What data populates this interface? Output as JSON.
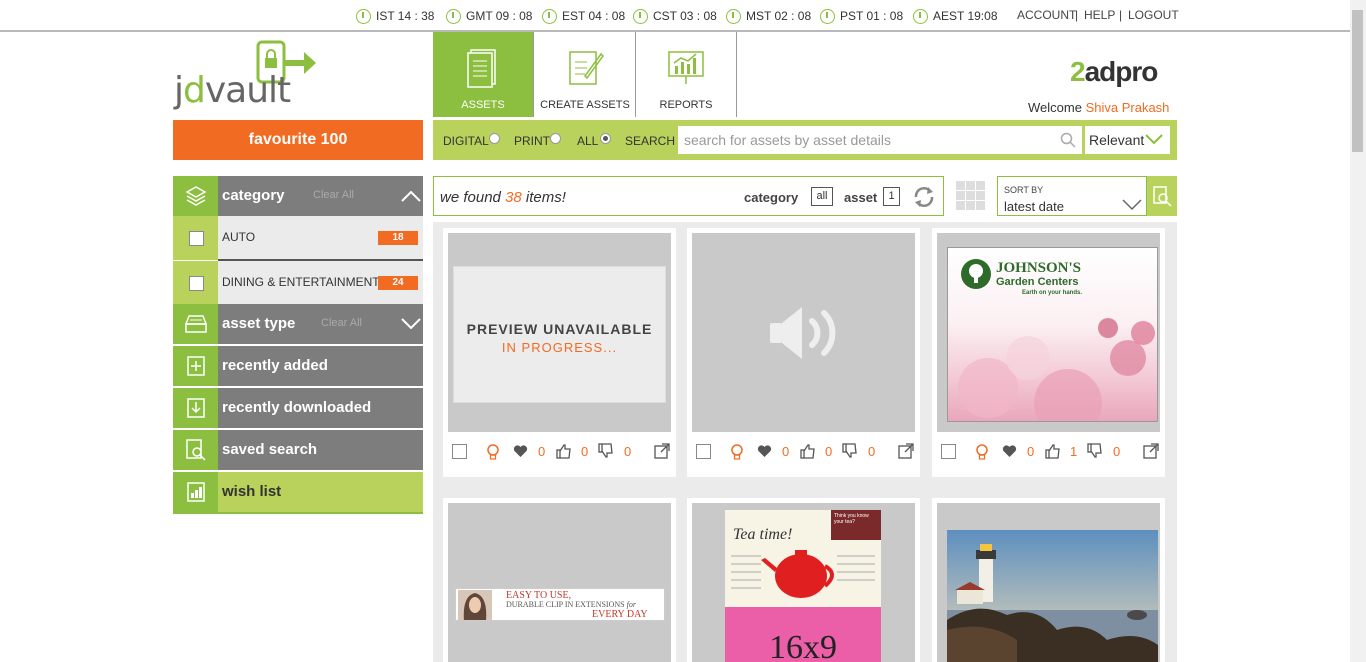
{
  "clocks": [
    {
      "label": "IST 14 : 38"
    },
    {
      "label": "GMT 09 : 08"
    },
    {
      "label": "EST 04 : 08"
    },
    {
      "label": "CST 03 : 08"
    },
    {
      "label": "MST 02 : 08"
    },
    {
      "label": "PST 01 : 08"
    },
    {
      "label": "AEST 19:08"
    }
  ],
  "toplinks": {
    "account": "ACCOUNT",
    "sep1": "|",
    "help": "HELP",
    "sep2": "|",
    "logout": "LOGOUT"
  },
  "logo": {
    "prefix": "j",
    "d": "d",
    "suffix": "vault"
  },
  "favourite": "favourite 100",
  "nav": {
    "assets": "ASSETS",
    "create": "CREATE ASSETS",
    "reports": "REPORTS"
  },
  "brand": {
    "num": "2",
    "rest": "adpro"
  },
  "welcome": {
    "label": "Welcome",
    "user": "Shiva Prakash"
  },
  "filters": {
    "digital": "DIGITAL",
    "print": "PRINT",
    "all": "ALL",
    "search": "SEARCH",
    "selected": "ALL"
  },
  "search": {
    "placeholder": "search for assets by asset details",
    "value": ""
  },
  "relevance": "Relevant",
  "sidebar": {
    "category": {
      "title": "category",
      "clear": "Clear All"
    },
    "items": [
      {
        "label": "AUTO",
        "count": "18"
      },
      {
        "label": "DINING & ENTERTAINMENT",
        "count": "24"
      }
    ],
    "asset_type": {
      "title": "asset type",
      "clear": "Clear All"
    },
    "recently_added": "recently added",
    "recently_downloaded": "recently downloaded",
    "saved_search": "saved search",
    "wish_list": "wish list"
  },
  "results": {
    "found_prefix": "we found",
    "count": "38",
    "found_suffix": "items!",
    "category_label": "category",
    "category_value": "all",
    "asset_label": "asset",
    "asset_value": "1"
  },
  "sort": {
    "label": "SORT BY",
    "value": "latest date"
  },
  "cards": [
    {
      "title": "PREVIEW UNAVAILABLE",
      "sub": "IN PROGRESS...",
      "likes": "0",
      "thumbs_up": "0",
      "thumbs_down": "0"
    },
    {
      "likes": "0",
      "thumbs_up": "0",
      "thumbs_down": "0"
    },
    {
      "brand": "JOHNSON'S",
      "brand2": "Garden Centers",
      "tagline": "Earth on your hands.",
      "likes": "0",
      "thumbs_up": "1",
      "thumbs_down": "0"
    },
    {
      "line1": "EASY TO USE,",
      "line2": "DURABLE CLIP IN EXTENSIONS",
      "line2b": "for",
      "line3": "EVERY DAY"
    },
    {
      "head": "Tea time!",
      "side": "Think you know your tea?",
      "big": "16x9"
    },
    {}
  ],
  "colors": {
    "green": "#8cbf3f",
    "lightgreen": "#b8d25c",
    "orange": "#f26b22",
    "grey": "#7d7d7d"
  }
}
